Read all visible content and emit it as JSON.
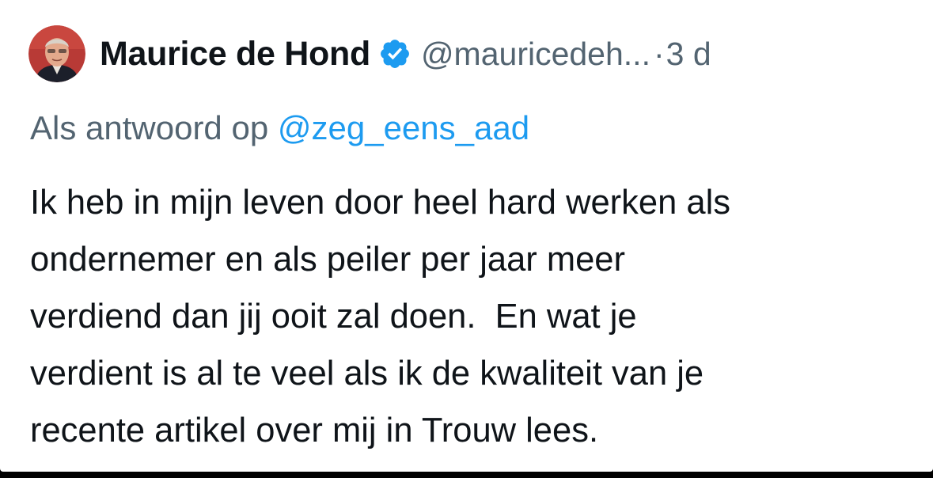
{
  "tweet": {
    "author": {
      "display_name": "Maurice de Hond",
      "handle": "@mauricedeh...",
      "verified": true,
      "avatar_icon": "profile-photo"
    },
    "separator": "·",
    "time": "3 d",
    "reply": {
      "prefix": "Als antwoord op",
      "mention": "@zeg_eens_aad"
    },
    "body_lines": [
      "Ik heb in mijn leven door heel hard werken als",
      "ondernemer en als peiler per jaar meer",
      "verdiend dan jij ooit zal doen.  En wat je",
      "verdient is al te veel als ik de kwaliteit van je",
      "recente artikel over mij in Trouw lees."
    ]
  },
  "colors": {
    "text_primary": "#0f1419",
    "text_secondary": "#536471",
    "accent": "#1d9bf0",
    "background": "#ffffff"
  }
}
